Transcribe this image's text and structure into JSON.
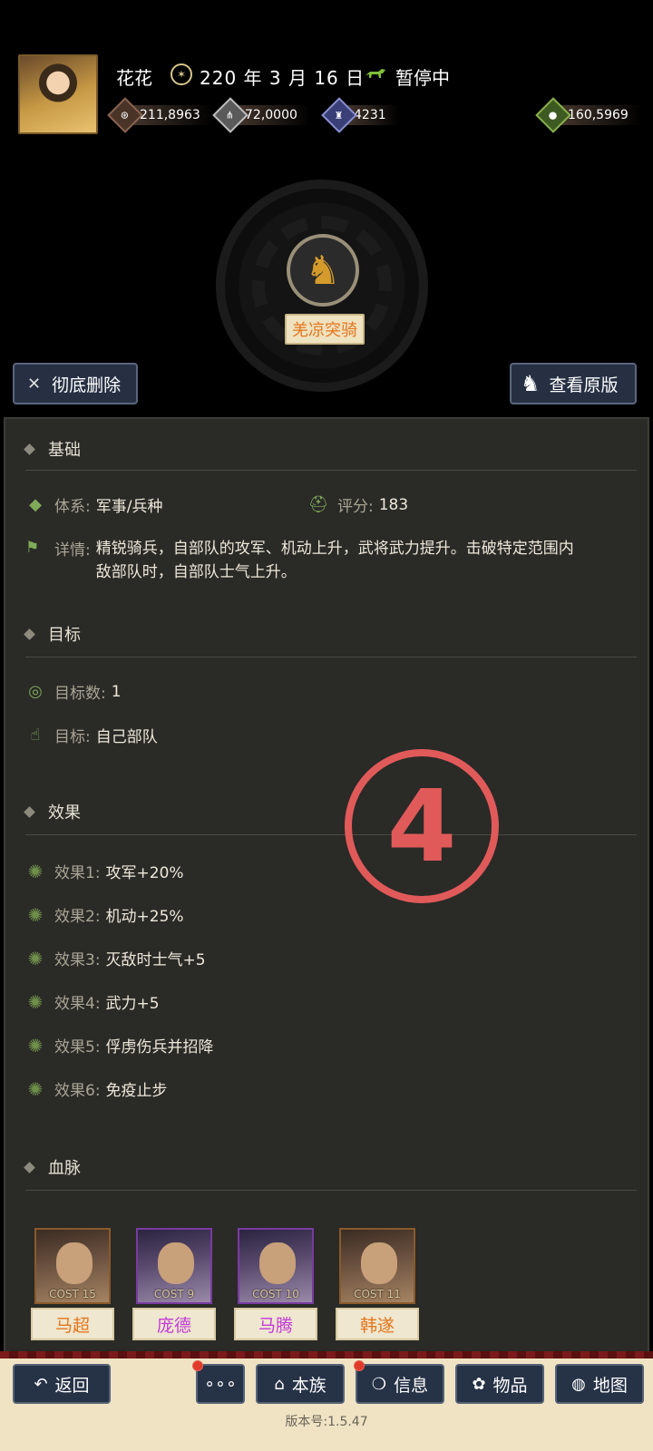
{
  "header": {
    "player_name": "花花",
    "date": "220 年 3 月 16 日",
    "status": "暂停中",
    "resources": [
      {
        "icon": "coin-icon",
        "value": "211,8963"
      },
      {
        "icon": "grain-icon",
        "value": "72,0000"
      },
      {
        "icon": "soldier-icon",
        "value": "4231"
      },
      {
        "icon": "money-bag-icon",
        "value": "160,5969"
      }
    ]
  },
  "unit": {
    "name": "羌凉突骑",
    "delete_label": "彻底删除",
    "view_label": "查看原版"
  },
  "basic": {
    "title": "基础",
    "system_label": "体系:",
    "system_value": "军事/兵种",
    "score_label": "评分:",
    "score_value": "183",
    "detail_label": "详情:",
    "detail_value": "精锐骑兵，自部队的攻军、机动上升，武将武力提升。击破特定范围内敌部队时，自部队士气上升。"
  },
  "target": {
    "title": "目标",
    "count_label": "目标数:",
    "count_value": "1",
    "target_label": "目标:",
    "target_value": "自己部队"
  },
  "effects": {
    "title": "效果",
    "items": [
      {
        "label": "效果1:",
        "value": "攻军+20%"
      },
      {
        "label": "效果2:",
        "value": "机动+25%"
      },
      {
        "label": "效果3:",
        "value": "灭敌时士气+5"
      },
      {
        "label": "效果4:",
        "value": "武力+5"
      },
      {
        "label": "效果5:",
        "value": "俘虏伤兵并招降"
      },
      {
        "label": "效果6:",
        "value": "免疫止步"
      }
    ]
  },
  "bloodline": {
    "title": "血脉",
    "heroes": [
      {
        "name": "马超",
        "cost": "COST 15",
        "name_color": "#e4761e"
      },
      {
        "name": "庞德",
        "cost": "COST 9",
        "name_color": "#c23ad8"
      },
      {
        "name": "马腾",
        "cost": "COST 10",
        "name_color": "#c23ad8"
      },
      {
        "name": "韩遂",
        "cost": "COST 11",
        "name_color": "#e4761e"
      }
    ]
  },
  "marker": "4",
  "nav": {
    "back": "返回",
    "more": "∘∘∘",
    "clan": "本族",
    "info": "信息",
    "items": "物品",
    "map": "地图"
  },
  "version": "版本号:1.5.47"
}
